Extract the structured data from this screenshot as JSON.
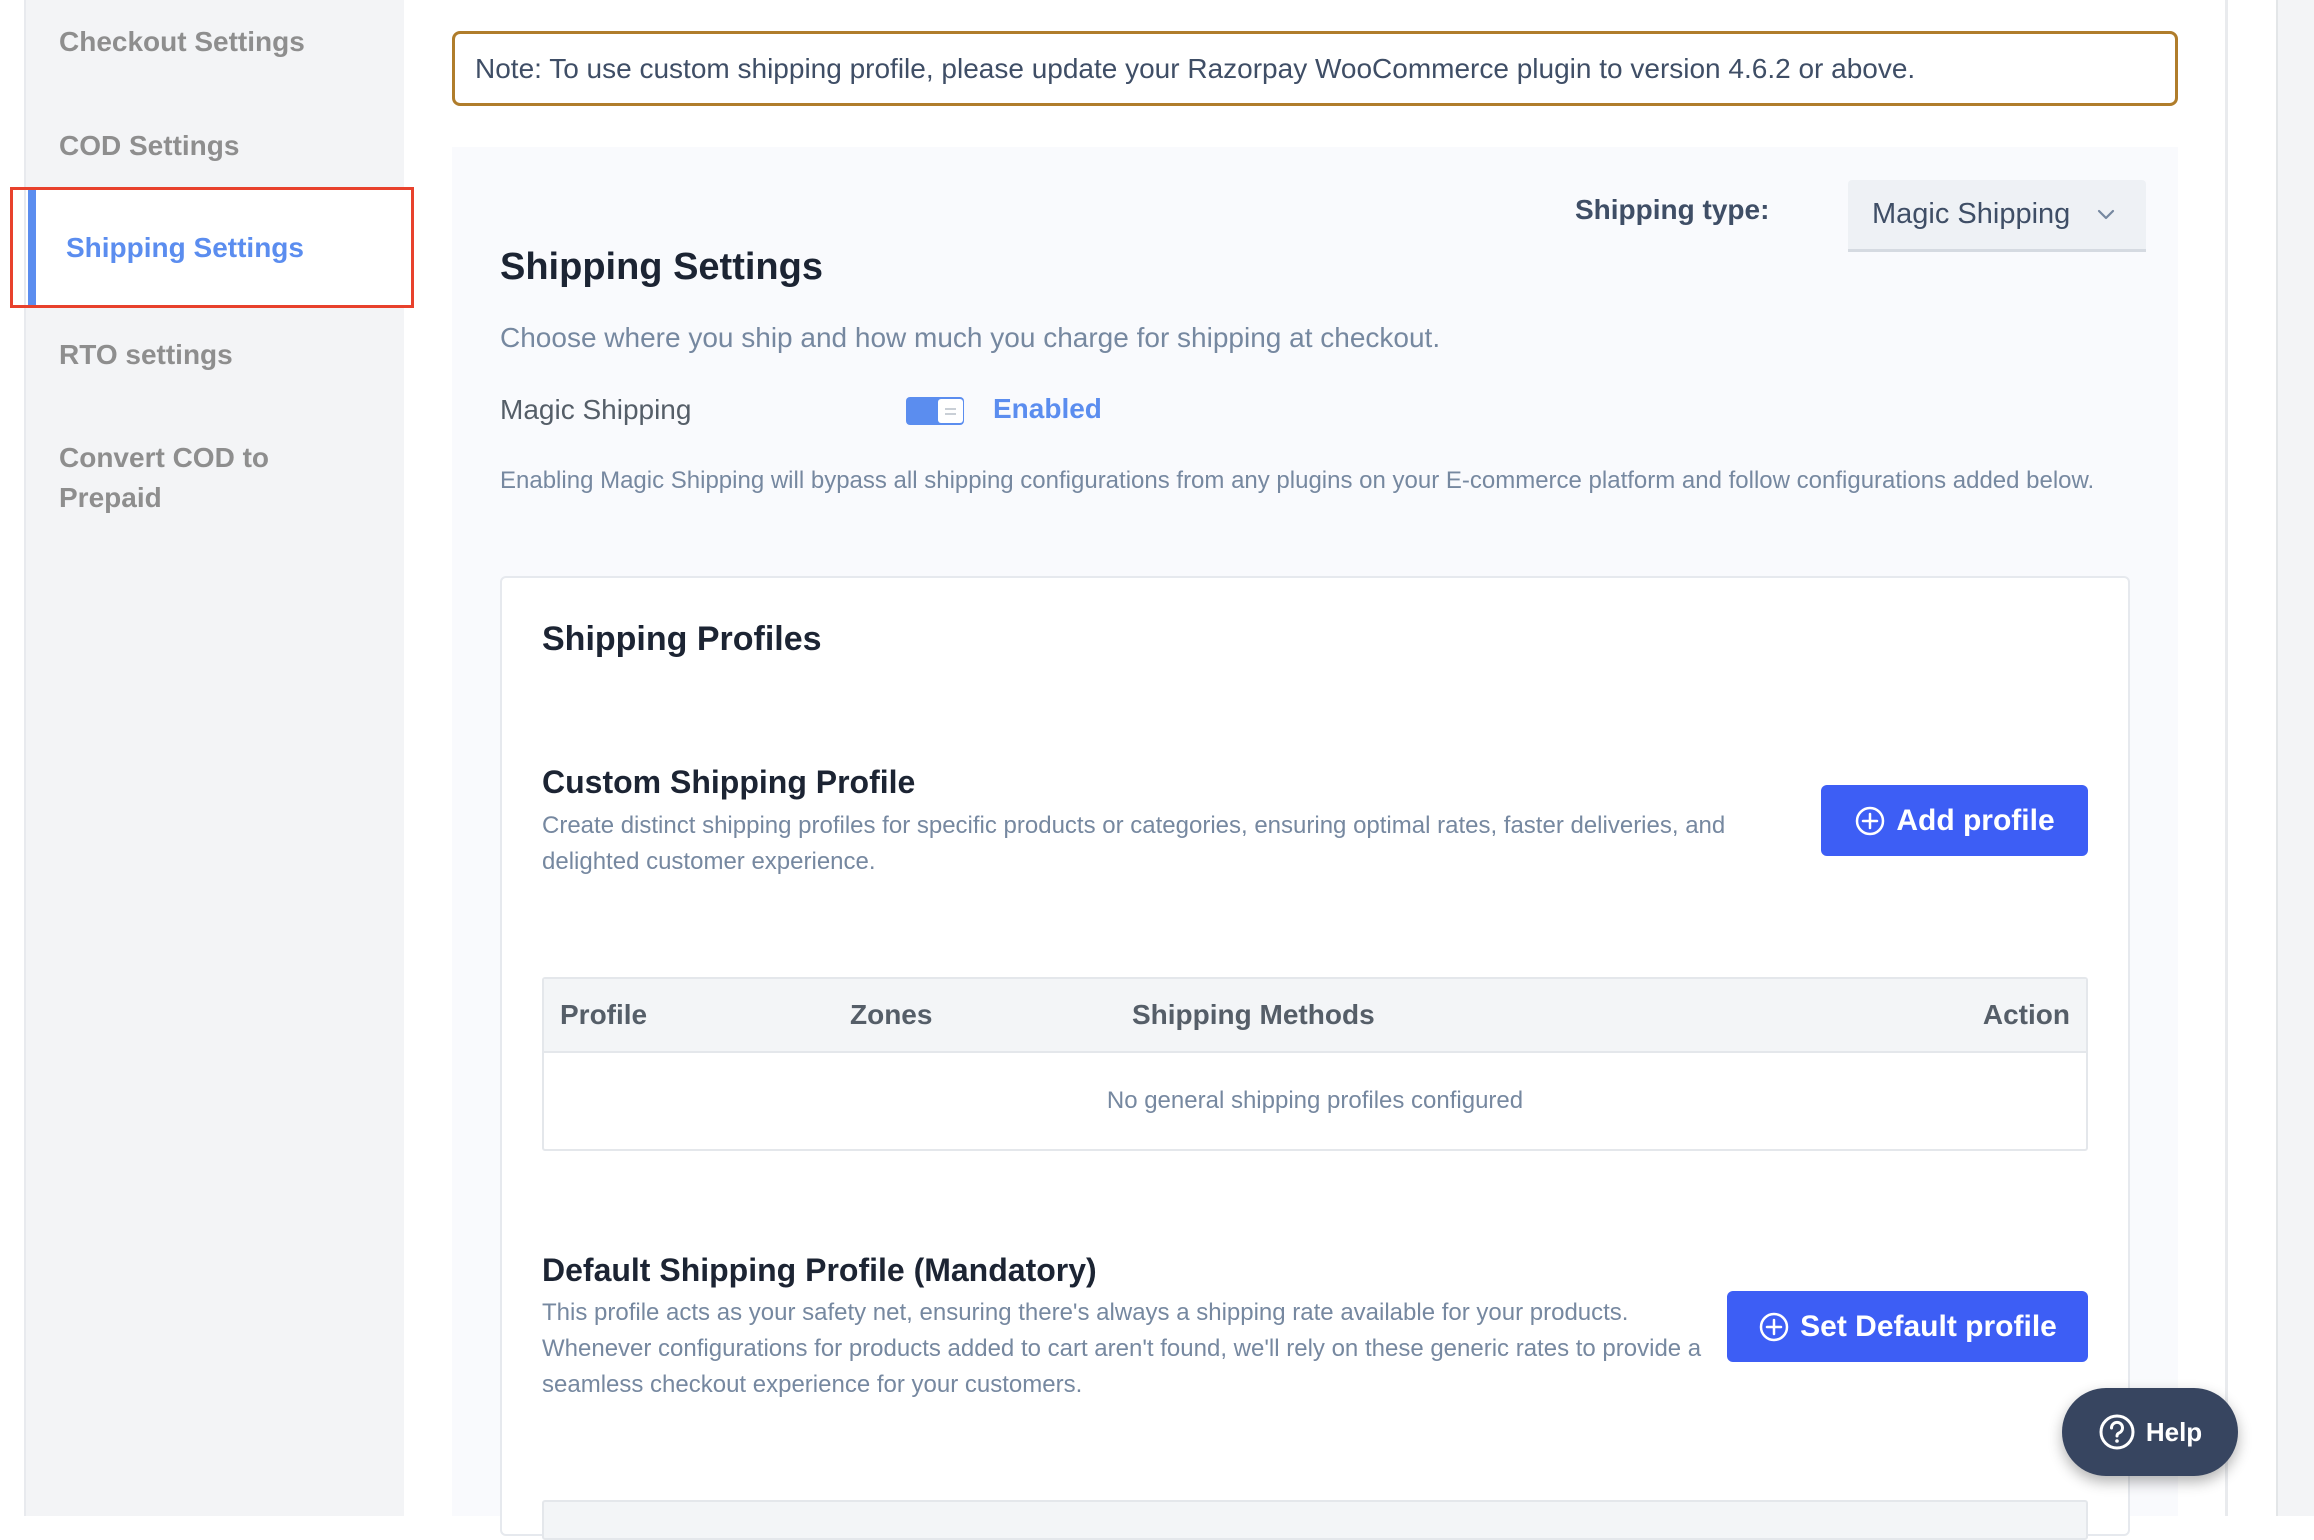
{
  "sidebar": {
    "items": [
      {
        "label": "Checkout Settings",
        "active": false
      },
      {
        "label": "COD Settings",
        "active": false
      },
      {
        "label": "Shipping Settings",
        "active": true
      },
      {
        "label": "RTO settings",
        "active": false
      },
      {
        "label": "Convert COD to Prepaid",
        "active": false
      }
    ]
  },
  "note": {
    "text": "Note: To use custom shipping profile, please update your Razorpay WooCommerce plugin to version 4.6.2 or above."
  },
  "shipping_type": {
    "label": "Shipping type:",
    "selected": "Magic Shipping",
    "icon": "chevron-down-icon"
  },
  "settings": {
    "title": "Shipping Settings",
    "subtitle": "Choose where you ship and how much you charge for shipping at checkout.",
    "magic_shipping_label": "Magic Shipping",
    "toggle_on": true,
    "toggle_status": "Enabled",
    "description": "Enabling Magic Shipping will bypass all shipping configurations from any plugins on your E-commerce platform and follow configurations added below."
  },
  "profiles": {
    "title": "Shipping Profiles",
    "custom": {
      "title": "Custom Shipping Profile",
      "description": "Create distinct shipping profiles for specific products or categories, ensuring optimal rates, faster deliveries, and delighted customer experience.",
      "button_label": "Add profile",
      "button_icon": "plus-circle-icon"
    },
    "table": {
      "columns": [
        "Profile",
        "Zones",
        "Shipping Methods",
        "Action"
      ],
      "empty_text": "No general shipping profiles configured"
    },
    "default": {
      "title": "Default Shipping Profile (Mandatory)",
      "description": "This profile acts as your safety net, ensuring there's always a shipping rate available for your products. Whenever configurations for products added to cart aren't found, we'll rely on these generic rates to provide a seamless checkout experience for your customers.",
      "button_label": "Set Default profile",
      "button_icon": "plus-circle-icon"
    }
  },
  "help": {
    "label": "Help",
    "icon": "question-circle-icon"
  },
  "colors": {
    "accent": "#5B8DEF",
    "primary_button": "#3D5EF5",
    "note_border": "#B07D2B",
    "highlight": "#E8412C",
    "help_bg": "#374560"
  }
}
